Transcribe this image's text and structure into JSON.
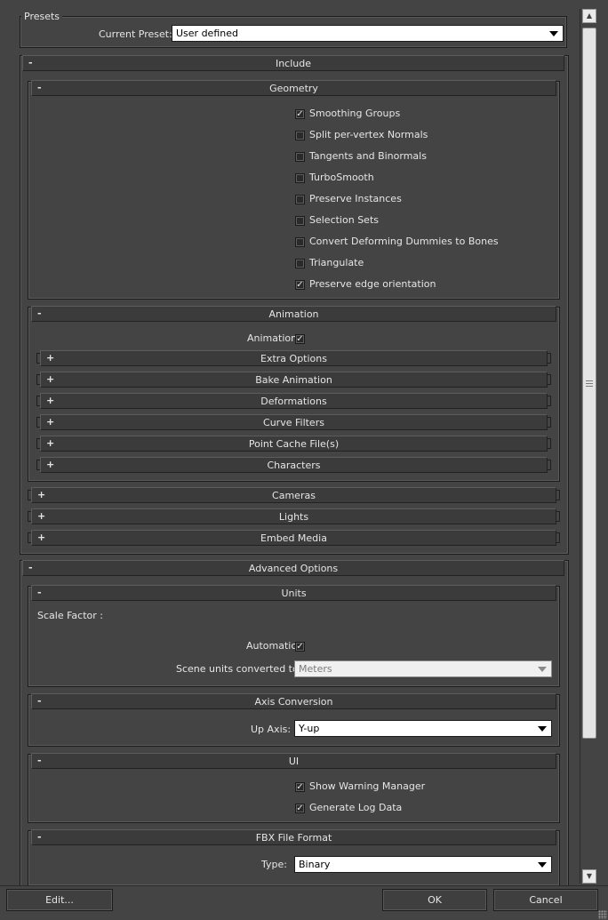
{
  "presets": {
    "legend": "Presets",
    "current_label": "Current Preset:",
    "current_value": "User defined"
  },
  "include": {
    "sign": "-",
    "title": "Include",
    "geometry": {
      "sign": "-",
      "title": "Geometry",
      "items": [
        {
          "label": "Smoothing Groups",
          "checked": "✓"
        },
        {
          "label": "Split per-vertex Normals",
          "checked": ""
        },
        {
          "label": "Tangents and Binormals",
          "checked": ""
        },
        {
          "label": "TurboSmooth",
          "checked": ""
        },
        {
          "label": "Preserve Instances",
          "checked": ""
        },
        {
          "label": "Selection Sets",
          "checked": ""
        },
        {
          "label": "Convert Deforming Dummies to Bones",
          "checked": ""
        },
        {
          "label": "Triangulate",
          "checked": ""
        },
        {
          "label": "Preserve edge orientation",
          "checked": "✓"
        }
      ]
    },
    "animation": {
      "sign": "-",
      "title": "Animation",
      "toggle_label": "Animation",
      "toggle_checked": "✓",
      "subsections": [
        {
          "sign": "+",
          "title": "Extra Options"
        },
        {
          "sign": "+",
          "title": "Bake Animation"
        },
        {
          "sign": "+",
          "title": "Deformations"
        },
        {
          "sign": "+",
          "title": "Curve Filters"
        },
        {
          "sign": "+",
          "title": "Point Cache File(s)"
        },
        {
          "sign": "+",
          "title": "Characters"
        }
      ]
    },
    "collapsed": [
      {
        "sign": "+",
        "title": "Cameras"
      },
      {
        "sign": "+",
        "title": "Lights"
      },
      {
        "sign": "+",
        "title": "Embed Media"
      }
    ]
  },
  "advanced": {
    "sign": "-",
    "title": "Advanced Options",
    "units": {
      "sign": "-",
      "title": "Units",
      "scale_label": "Scale Factor :",
      "automatic_label": "Automatic",
      "automatic_checked": "✓",
      "converted_label": "Scene units converted to:",
      "converted_value": "Meters"
    },
    "axis": {
      "sign": "-",
      "title": "Axis Conversion",
      "up_label": "Up Axis:",
      "up_value": "Y-up"
    },
    "ui": {
      "sign": "-",
      "title": "UI",
      "items": [
        {
          "label": "Show Warning Manager",
          "checked": "✓"
        },
        {
          "label": "Generate Log Data",
          "checked": "✓"
        }
      ]
    },
    "fbx": {
      "sign": "-",
      "title": "FBX File Format",
      "type_label": "Type:",
      "type_value": "Binary"
    }
  },
  "scrollbar": {
    "up_glyph": "▲",
    "down_glyph": "▼",
    "thumb_position": 0.43
  },
  "footer": {
    "edit": "Edit...",
    "ok": "OK",
    "cancel": "Cancel"
  }
}
